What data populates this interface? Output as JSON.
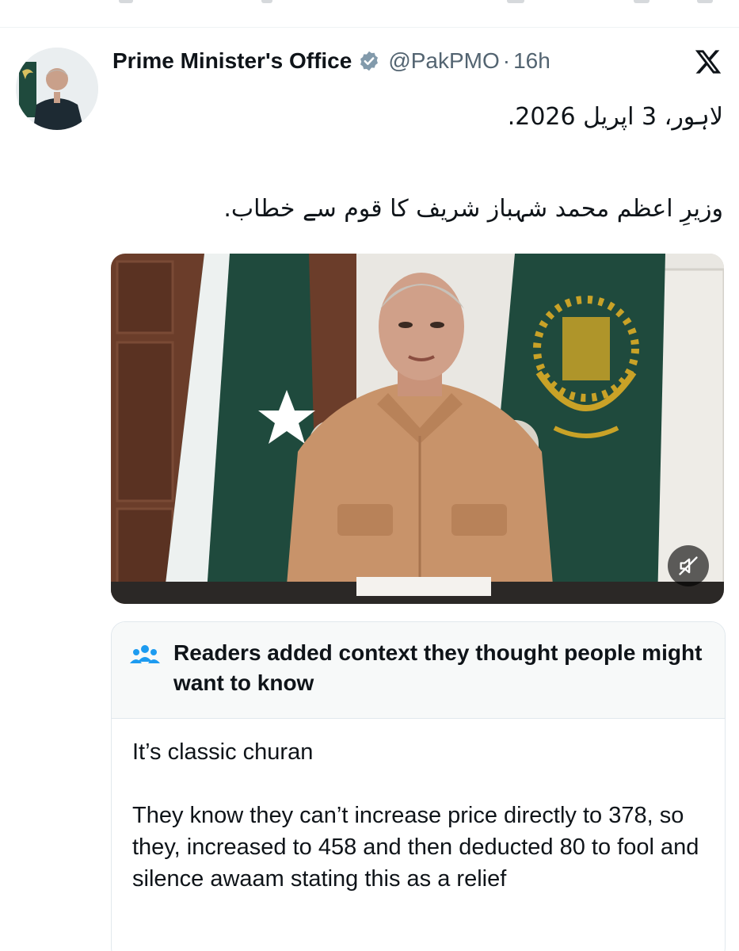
{
  "tweet": {
    "author": {
      "display_name": "Prime Minister's Office",
      "handle": "@PakPMO",
      "separator": "·",
      "time": "16h",
      "verified_icon": "verified-badge-icon",
      "avatar_icon": "profile-avatar"
    },
    "platform_icon": "x-logo-icon",
    "text_lines": [
      "لاہور، 3 اپریل 2026.",
      "وزیرِ اعظم محمد شہباز شریف کا قوم سے خطاب."
    ],
    "media": {
      "type": "video",
      "mute_icon": "volume-muted-icon"
    }
  },
  "community_note": {
    "icon": "readers-group-icon",
    "heading": "Readers added context they thought people might want to know",
    "paragraphs": [
      "It’s classic churan",
      "They know they can’t increase price directly to 378, so they, increased to 458 and then deducted 80 to fool and silence awaam stating this as a relief"
    ]
  },
  "colors": {
    "text_primary": "#0f1419",
    "text_secondary": "#536471",
    "verified_badge": "#829aab",
    "note_header_bg": "#f7f9f9",
    "note_border": "#e1e8ed",
    "note_icon": "#1d9bf0",
    "flag_green": "#1f4a3d",
    "emblem_gold": "#c9a227"
  }
}
